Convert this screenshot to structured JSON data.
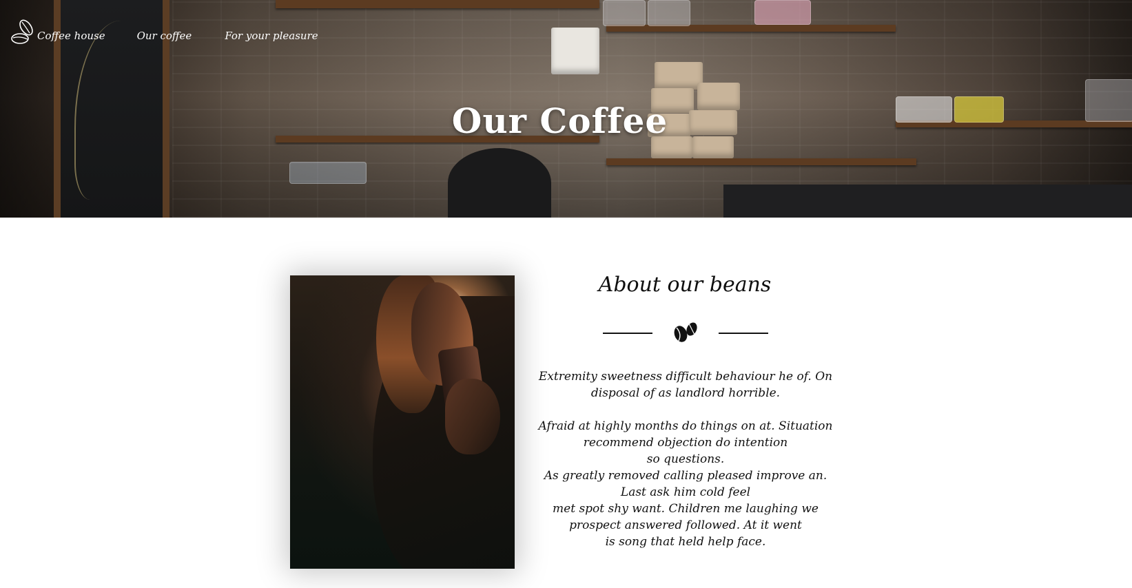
{
  "nav": {
    "logo_icon": "coffee-bean-icon",
    "items": [
      {
        "label": "Coffee house"
      },
      {
        "label": "Our coffee"
      },
      {
        "label": "For your pleasure"
      }
    ]
  },
  "hero": {
    "title": "Our Coffee"
  },
  "about": {
    "heading": "About our beans",
    "divider_icon": "coffee-beans-icon",
    "paragraph_1": [
      "Extremity sweetness difficult behaviour he of. On",
      "disposal of as landlord horrible."
    ],
    "paragraph_2": [
      "Afraid at highly months do things on at. Situation",
      "recommend objection do intention",
      "so questions.",
      "As greatly removed calling pleased improve an.",
      "Last ask him cold feel",
      "met spot shy want. Children me laughing we",
      "prospect answered followed. At it went",
      "is song that held help face."
    ]
  },
  "colors": {
    "text_dark": "#0f0f0f",
    "nav_text": "#ffffff",
    "background": "#ffffff"
  }
}
